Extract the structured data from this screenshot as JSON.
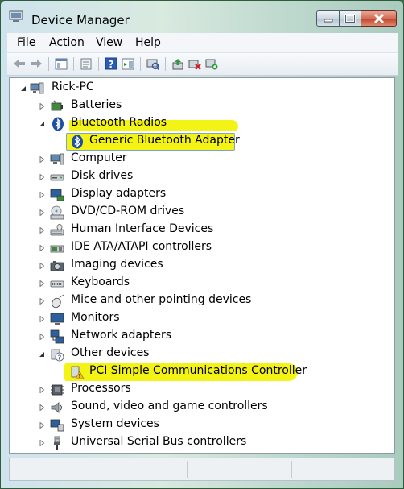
{
  "window": {
    "title": "Device Manager",
    "controls": [
      "minimize",
      "maximize",
      "close"
    ]
  },
  "menu": [
    "File",
    "Action",
    "View",
    "Help"
  ],
  "toolbar": {
    "icons": [
      "back-icon",
      "forward-icon",
      "show-hide-console-tree-icon",
      "properties-icon",
      "help-icon",
      "action-pane-icon",
      "scan-hardware-icon",
      "update-driver-icon",
      "uninstall-icon",
      "add-legacy-icon"
    ]
  },
  "tree": {
    "root": "Rick-PC",
    "items": [
      {
        "label": "Batteries",
        "icon": "battery-icon",
        "expanded": false
      },
      {
        "label": "Bluetooth Radios",
        "icon": "bluetooth-icon",
        "expanded": true
      },
      {
        "label": "Generic Bluetooth Adapter",
        "icon": "bluetooth-icon",
        "child": true,
        "selected": true
      },
      {
        "label": "Computer",
        "icon": "computer-icon",
        "expanded": false
      },
      {
        "label": "Disk drives",
        "icon": "disk-drive-icon",
        "expanded": false
      },
      {
        "label": "Display adapters",
        "icon": "display-adapter-icon",
        "expanded": false
      },
      {
        "label": "DVD/CD-ROM drives",
        "icon": "optical-drive-icon",
        "expanded": false
      },
      {
        "label": "Human Interface Devices",
        "icon": "hid-icon",
        "expanded": false
      },
      {
        "label": "IDE ATA/ATAPI controllers",
        "icon": "ide-controller-icon",
        "expanded": false
      },
      {
        "label": "Imaging devices",
        "icon": "camera-icon",
        "expanded": false
      },
      {
        "label": "Keyboards",
        "icon": "keyboard-icon",
        "expanded": false
      },
      {
        "label": "Mice and other pointing devices",
        "icon": "mouse-icon",
        "expanded": false
      },
      {
        "label": "Monitors",
        "icon": "monitor-icon",
        "expanded": false
      },
      {
        "label": "Network adapters",
        "icon": "network-adapter-icon",
        "expanded": false
      },
      {
        "label": "Other devices",
        "icon": "other-devices-icon",
        "expanded": true
      },
      {
        "label": "PCI Simple Communications Controller",
        "icon": "unknown-device-warning-icon",
        "child": true
      },
      {
        "label": "Processors",
        "icon": "processor-icon",
        "expanded": false
      },
      {
        "label": "Sound, video and game controllers",
        "icon": "sound-icon",
        "expanded": false
      },
      {
        "label": "System devices",
        "icon": "system-devices-icon",
        "expanded": false
      },
      {
        "label": "Universal Serial Bus controllers",
        "icon": "usb-icon",
        "expanded": false
      }
    ]
  },
  "colors": {
    "highlight": "#f4f316",
    "selection_border": "#7da2ce",
    "tree_background": "#ffffff"
  }
}
